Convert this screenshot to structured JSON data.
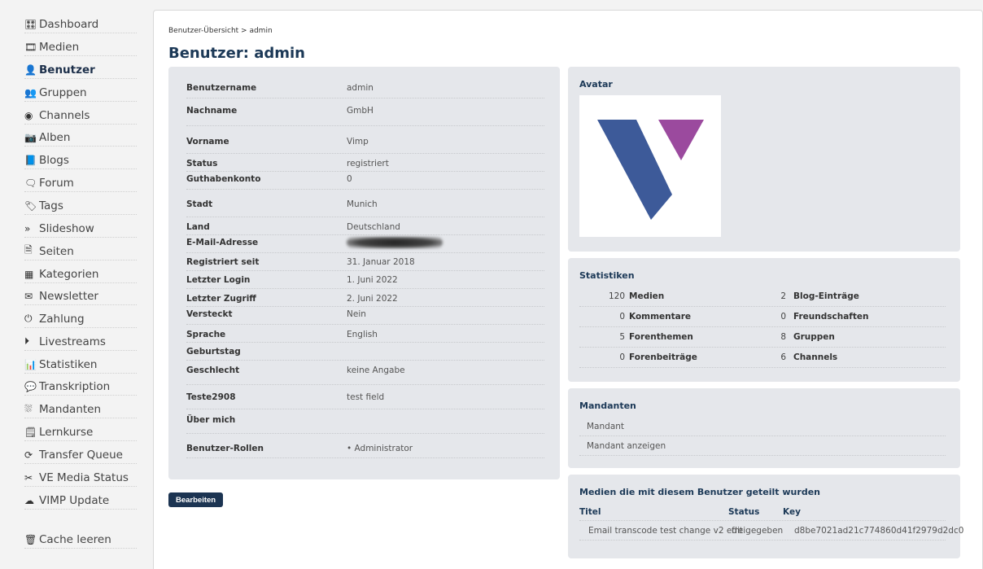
{
  "sidebar": {
    "items": [
      {
        "label": "Dashboard",
        "icon": "tachometer-icon",
        "glyph": "🎛"
      },
      {
        "label": "Medien",
        "icon": "film-icon",
        "glyph": "🎞"
      },
      {
        "label": "Benutzer",
        "icon": "user-icon",
        "glyph": "👤",
        "active": true
      },
      {
        "label": "Gruppen",
        "icon": "users-icon",
        "glyph": "👥"
      },
      {
        "label": "Channels",
        "icon": "dot-circle-icon",
        "glyph": "◉"
      },
      {
        "label": "Alben",
        "icon": "camera-icon",
        "glyph": "📷"
      },
      {
        "label": "Blogs",
        "icon": "book-icon",
        "glyph": "📘"
      },
      {
        "label": "Forum",
        "icon": "comments-icon",
        "glyph": "🗨"
      },
      {
        "label": "Tags",
        "icon": "tags-icon",
        "glyph": "🏷"
      },
      {
        "label": "Slideshow",
        "icon": "angle-double-right-icon",
        "glyph": "»"
      },
      {
        "label": "Seiten",
        "icon": "file-icon",
        "glyph": "🗎"
      },
      {
        "label": "Kategorien",
        "icon": "th-icon",
        "glyph": "▦"
      },
      {
        "label": "Newsletter",
        "icon": "envelope-icon",
        "glyph": "✉"
      },
      {
        "label": "Zahlung",
        "icon": "power-icon",
        "glyph": "⏻"
      },
      {
        "label": "Livestreams",
        "icon": "play-circle-icon",
        "glyph": "⏵"
      },
      {
        "label": "Statistiken",
        "icon": "bar-chart-icon",
        "glyph": "📊"
      },
      {
        "label": "Transkription",
        "icon": "comment-icon",
        "glyph": "💬"
      },
      {
        "label": "Mandanten",
        "icon": "sitemap-icon",
        "glyph": "⛆"
      },
      {
        "label": "Lernkurse",
        "icon": "file-text-icon",
        "glyph": "🗒"
      },
      {
        "label": "Transfer Queue",
        "icon": "sync-icon",
        "glyph": "⟳"
      },
      {
        "label": "VE Media Status",
        "icon": "scissors-icon",
        "glyph": "✂"
      },
      {
        "label": "VIMP Update",
        "icon": "cloud-download-icon",
        "glyph": "☁"
      }
    ],
    "cache": {
      "label": "Cache leeren",
      "icon": "trash-icon",
      "glyph": "🗑"
    }
  },
  "breadcrumb": "Benutzer-Übersicht > admin",
  "page_title": "Benutzer: admin",
  "details": [
    {
      "label": "Benutzername",
      "value": "admin"
    },
    {
      "label": "Nachname",
      "value": "GmbH"
    },
    {
      "label": "Vorname",
      "value": "Vimp"
    },
    {
      "label": "Status",
      "value": "registriert"
    },
    {
      "label": "Guthabenkonto",
      "value": "0"
    },
    {
      "label": "Stadt",
      "value": "Munich"
    },
    {
      "label": "Land",
      "value": "Deutschland"
    },
    {
      "label": "E-Mail-Adresse",
      "value": "webmaster@vimp.com",
      "blurred": true
    },
    {
      "label": "Registriert seit",
      "value": "31. Januar 2018"
    },
    {
      "label": "Letzter Login",
      "value": "1. Juni 2022"
    },
    {
      "label": "Letzter Zugriff",
      "value": "2. Juni 2022"
    },
    {
      "label": "Versteckt",
      "value": "Nein"
    },
    {
      "label": "Sprache",
      "value": "English"
    },
    {
      "label": "Geburtstag",
      "value": ""
    },
    {
      "label": "Geschlecht",
      "value": "keine Angabe"
    },
    {
      "label": "Teste2908",
      "value": "test field"
    },
    {
      "label": "Über mich",
      "value": ""
    },
    {
      "label": "Benutzer-Rollen",
      "value": "•  Administrator"
    }
  ],
  "edit_button": "Bearbeiten",
  "avatar": {
    "title": "Avatar",
    "colors": {
      "blue": "#3d5a99",
      "purple": "#9b4a9e"
    }
  },
  "stats": {
    "title": "Statistiken",
    "rows": [
      {
        "left_num": "120",
        "left_label": "Medien",
        "right_num": "2",
        "right_label": "Blog-Einträge"
      },
      {
        "left_num": "0",
        "left_label": "Kommentare",
        "right_num": "0",
        "right_label": "Freundschaften"
      },
      {
        "left_num": "5",
        "left_label": "Forenthemen",
        "right_num": "8",
        "right_label": "Gruppen"
      },
      {
        "left_num": "0",
        "left_label": "Forenbeiträge",
        "right_num": "6",
        "right_label": "Channels"
      }
    ]
  },
  "mandanten": {
    "title": "Mandanten",
    "rows": [
      "Mandant",
      "Mandant anzeigen"
    ]
  },
  "shared": {
    "title": "Medien die mit diesem Benutzer geteilt wurden",
    "headers": [
      "Titel",
      "Status",
      "Key"
    ],
    "rows": [
      [
        "Email transcode test change v2 edit",
        "freigegeben",
        "d8be7021ad21c774860d41f2979d2dc0"
      ]
    ]
  },
  "colors": {
    "accent": "#1c3957",
    "button": "#1c3452",
    "card": "#e5e7eb"
  }
}
